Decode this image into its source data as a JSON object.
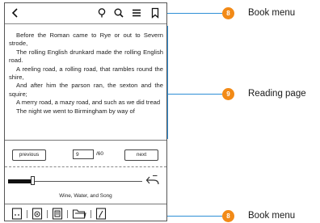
{
  "reader": {
    "partial_heading": "",
    "paragraphs": [
      "Before the Roman came to Rye or out to Severn strode,",
      "The rolling English drunkard made the rolling English road.",
      "A reeling road, a rolling road, that rambles round the shire,",
      "And after him the parson ran, the sexton and the squire;",
      "A merry road, a mazy road, and such as we did tread",
      "The night we went to Birmingham by way of"
    ],
    "nav": {
      "previous_label": "previous",
      "page_value": "9",
      "page_total": "/60",
      "next_label": "next"
    },
    "progress": 0.17,
    "chapter_title": "Wine, Water, and Song"
  },
  "icons": {
    "top": [
      "back-arrow-icon",
      "bulb-icon",
      "search-icon",
      "menu-icon",
      "bookmark-icon"
    ],
    "bottom": [
      "page-layout-icon",
      "settings-icon",
      "toc-icon",
      "folder-icon",
      "notes-icon"
    ]
  },
  "callouts": [
    {
      "badge": "8",
      "label": "Book menu"
    },
    {
      "badge": "9",
      "label": "Reading page"
    },
    {
      "badge": "8",
      "label": "Book menu"
    }
  ],
  "colors": {
    "callout_line": "#2f8fd6",
    "badge": "#f28a17"
  }
}
